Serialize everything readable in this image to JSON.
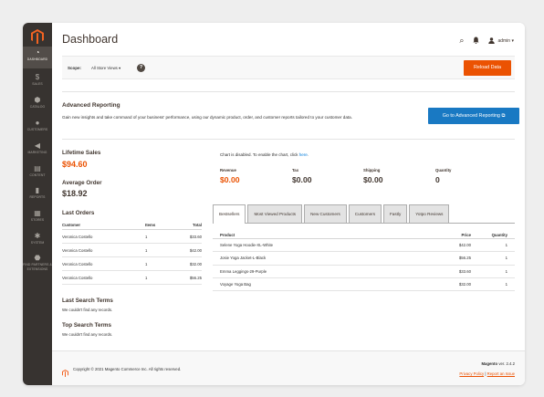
{
  "sidebar": {
    "items": [
      {
        "label": "Dashboard",
        "icon": "dashboard-icon",
        "glyph": "◔"
      },
      {
        "label": "Sales",
        "icon": "dollar-icon",
        "glyph": "$"
      },
      {
        "label": "Catalog",
        "icon": "catalog-icon",
        "glyph": "⬢"
      },
      {
        "label": "Customers",
        "icon": "customers-icon",
        "glyph": "●"
      },
      {
        "label": "Marketing",
        "icon": "megaphone-icon",
        "glyph": "◀"
      },
      {
        "label": "Content",
        "icon": "content-icon",
        "glyph": "▤"
      },
      {
        "label": "Reports",
        "icon": "reports-icon",
        "glyph": "▮"
      },
      {
        "label": "Stores",
        "icon": "stores-icon",
        "glyph": "▦"
      },
      {
        "label": "System",
        "icon": "gear-icon",
        "glyph": "✱"
      },
      {
        "label": "Find Partners & Extensions",
        "icon": "partners-icon",
        "glyph": "⬣"
      }
    ]
  },
  "header": {
    "title": "Dashboard",
    "admin_label": "admin",
    "search_icon": "⌕",
    "bell_icon": "🔔",
    "user_icon": "👤",
    "caret": "▾"
  },
  "scope": {
    "label": "Scope:",
    "value": "All Store Views",
    "caret": "▾",
    "help": "?",
    "reload_label": "Reload Data"
  },
  "advanced": {
    "title": "Advanced Reporting",
    "text": "Gain new insights and take command of your business' performance, using our dynamic product, order, and customer reports tailored to your customer data.",
    "button_label": "Go to Advanced Reporting",
    "button_icon": "⧉"
  },
  "stats": {
    "lifetime_label": "Lifetime Sales",
    "lifetime_value": "$94.60",
    "avg_label": "Average Order",
    "avg_value": "$18.92"
  },
  "last_orders": {
    "title": "Last Orders",
    "headers": {
      "customer": "Customer",
      "items": "Items",
      "total": "Total"
    },
    "rows": [
      {
        "customer": "Veronica Costello",
        "items": "1",
        "total": "$33.60"
      },
      {
        "customer": "Veronica Costello",
        "items": "1",
        "total": "$42.00"
      },
      {
        "customer": "Veronica Costello",
        "items": "1",
        "total": "$32.00"
      },
      {
        "customer": "Veronica Costello",
        "items": "1",
        "total": "$56.25"
      }
    ]
  },
  "last_search": {
    "title": "Last Search Terms",
    "empty": "We couldn't find any records."
  },
  "top_search": {
    "title": "Top Search Terms",
    "empty": "We couldn't find any records."
  },
  "chart": {
    "disabled_text": "Chart is disabled. To enable the chart, click ",
    "link": "here",
    "end": "."
  },
  "totals": [
    {
      "label": "Revenue",
      "value": "$0.00",
      "color": "#eb5202"
    },
    {
      "label": "Tax",
      "value": "$0.00",
      "color": "#41362f"
    },
    {
      "label": "Shipping",
      "value": "$0.00",
      "color": "#41362f"
    },
    {
      "label": "Quantity",
      "value": "0",
      "color": "#41362f"
    }
  ],
  "tabs": [
    {
      "label": "Bestsellers",
      "active": true
    },
    {
      "label": "Most Viewed Products",
      "active": false
    },
    {
      "label": "New Customers",
      "active": false
    },
    {
      "label": "Customers",
      "active": false
    },
    {
      "label": "Fastly",
      "active": false
    },
    {
      "label": "Yotpo Reviews",
      "active": false
    }
  ],
  "bestsellers": {
    "headers": {
      "product": "Product",
      "price": "Price",
      "quantity": "Quantity"
    },
    "rows": [
      {
        "product": "Selene Yoga Hoodie-XL-White",
        "price": "$42.00",
        "quantity": "1"
      },
      {
        "product": "Josie Yoga Jacket-L-Black",
        "price": "$56.25",
        "quantity": "1"
      },
      {
        "product": "Emma Leggings-29-Purple",
        "price": "$33.60",
        "quantity": "1"
      },
      {
        "product": "Voyage Yoga Bag",
        "price": "$32.00",
        "quantity": "1"
      }
    ]
  },
  "footer": {
    "copyright": "Copyright © 2021 Magento Commerce Inc. All rights reserved.",
    "brand": "Magento",
    "version": " ver. 2.4.2",
    "privacy": "Privacy Policy",
    "separator": " | ",
    "report": "Report an Issue"
  },
  "colors": {
    "accent": "#eb5202",
    "primary": "#1979c3",
    "sidebar": "#373330"
  }
}
